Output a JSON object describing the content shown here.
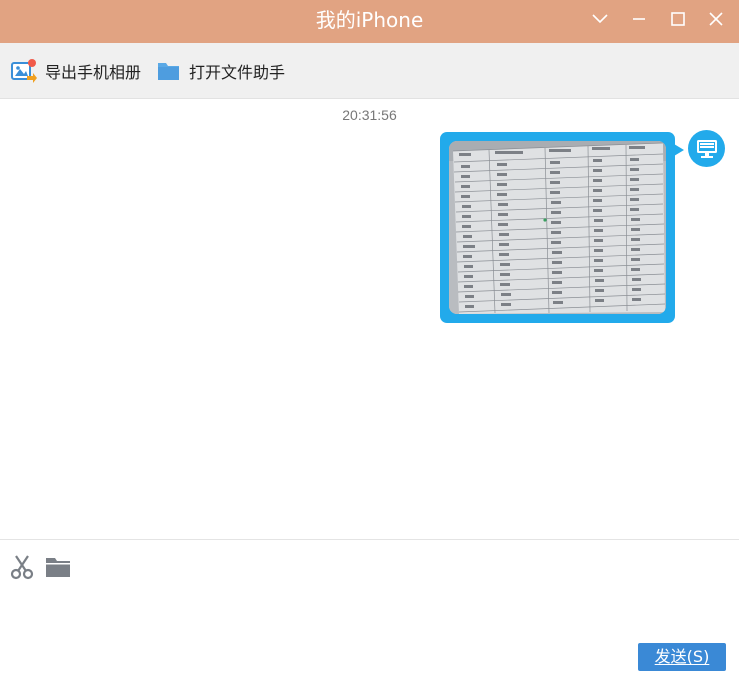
{
  "window": {
    "title": "我的iPhone",
    "controls": [
      "minimize-chevron",
      "minimize",
      "maximize",
      "close"
    ]
  },
  "toolbar": {
    "export_album_label": "导出手机相册",
    "open_file_assistant_label": "打开文件助手"
  },
  "chat": {
    "timestamp": "20:31:56",
    "message": {
      "type": "image",
      "sender_icon": "computer-monitor-icon"
    }
  },
  "input": {
    "tools": [
      "scissors-icon",
      "folder-icon"
    ],
    "send_label": "发送(S)"
  },
  "colors": {
    "titlebar": "#e1a382",
    "bubble": "#22aaeb",
    "send_button": "#3a89d6",
    "toolbar": "#f0f0f0"
  }
}
